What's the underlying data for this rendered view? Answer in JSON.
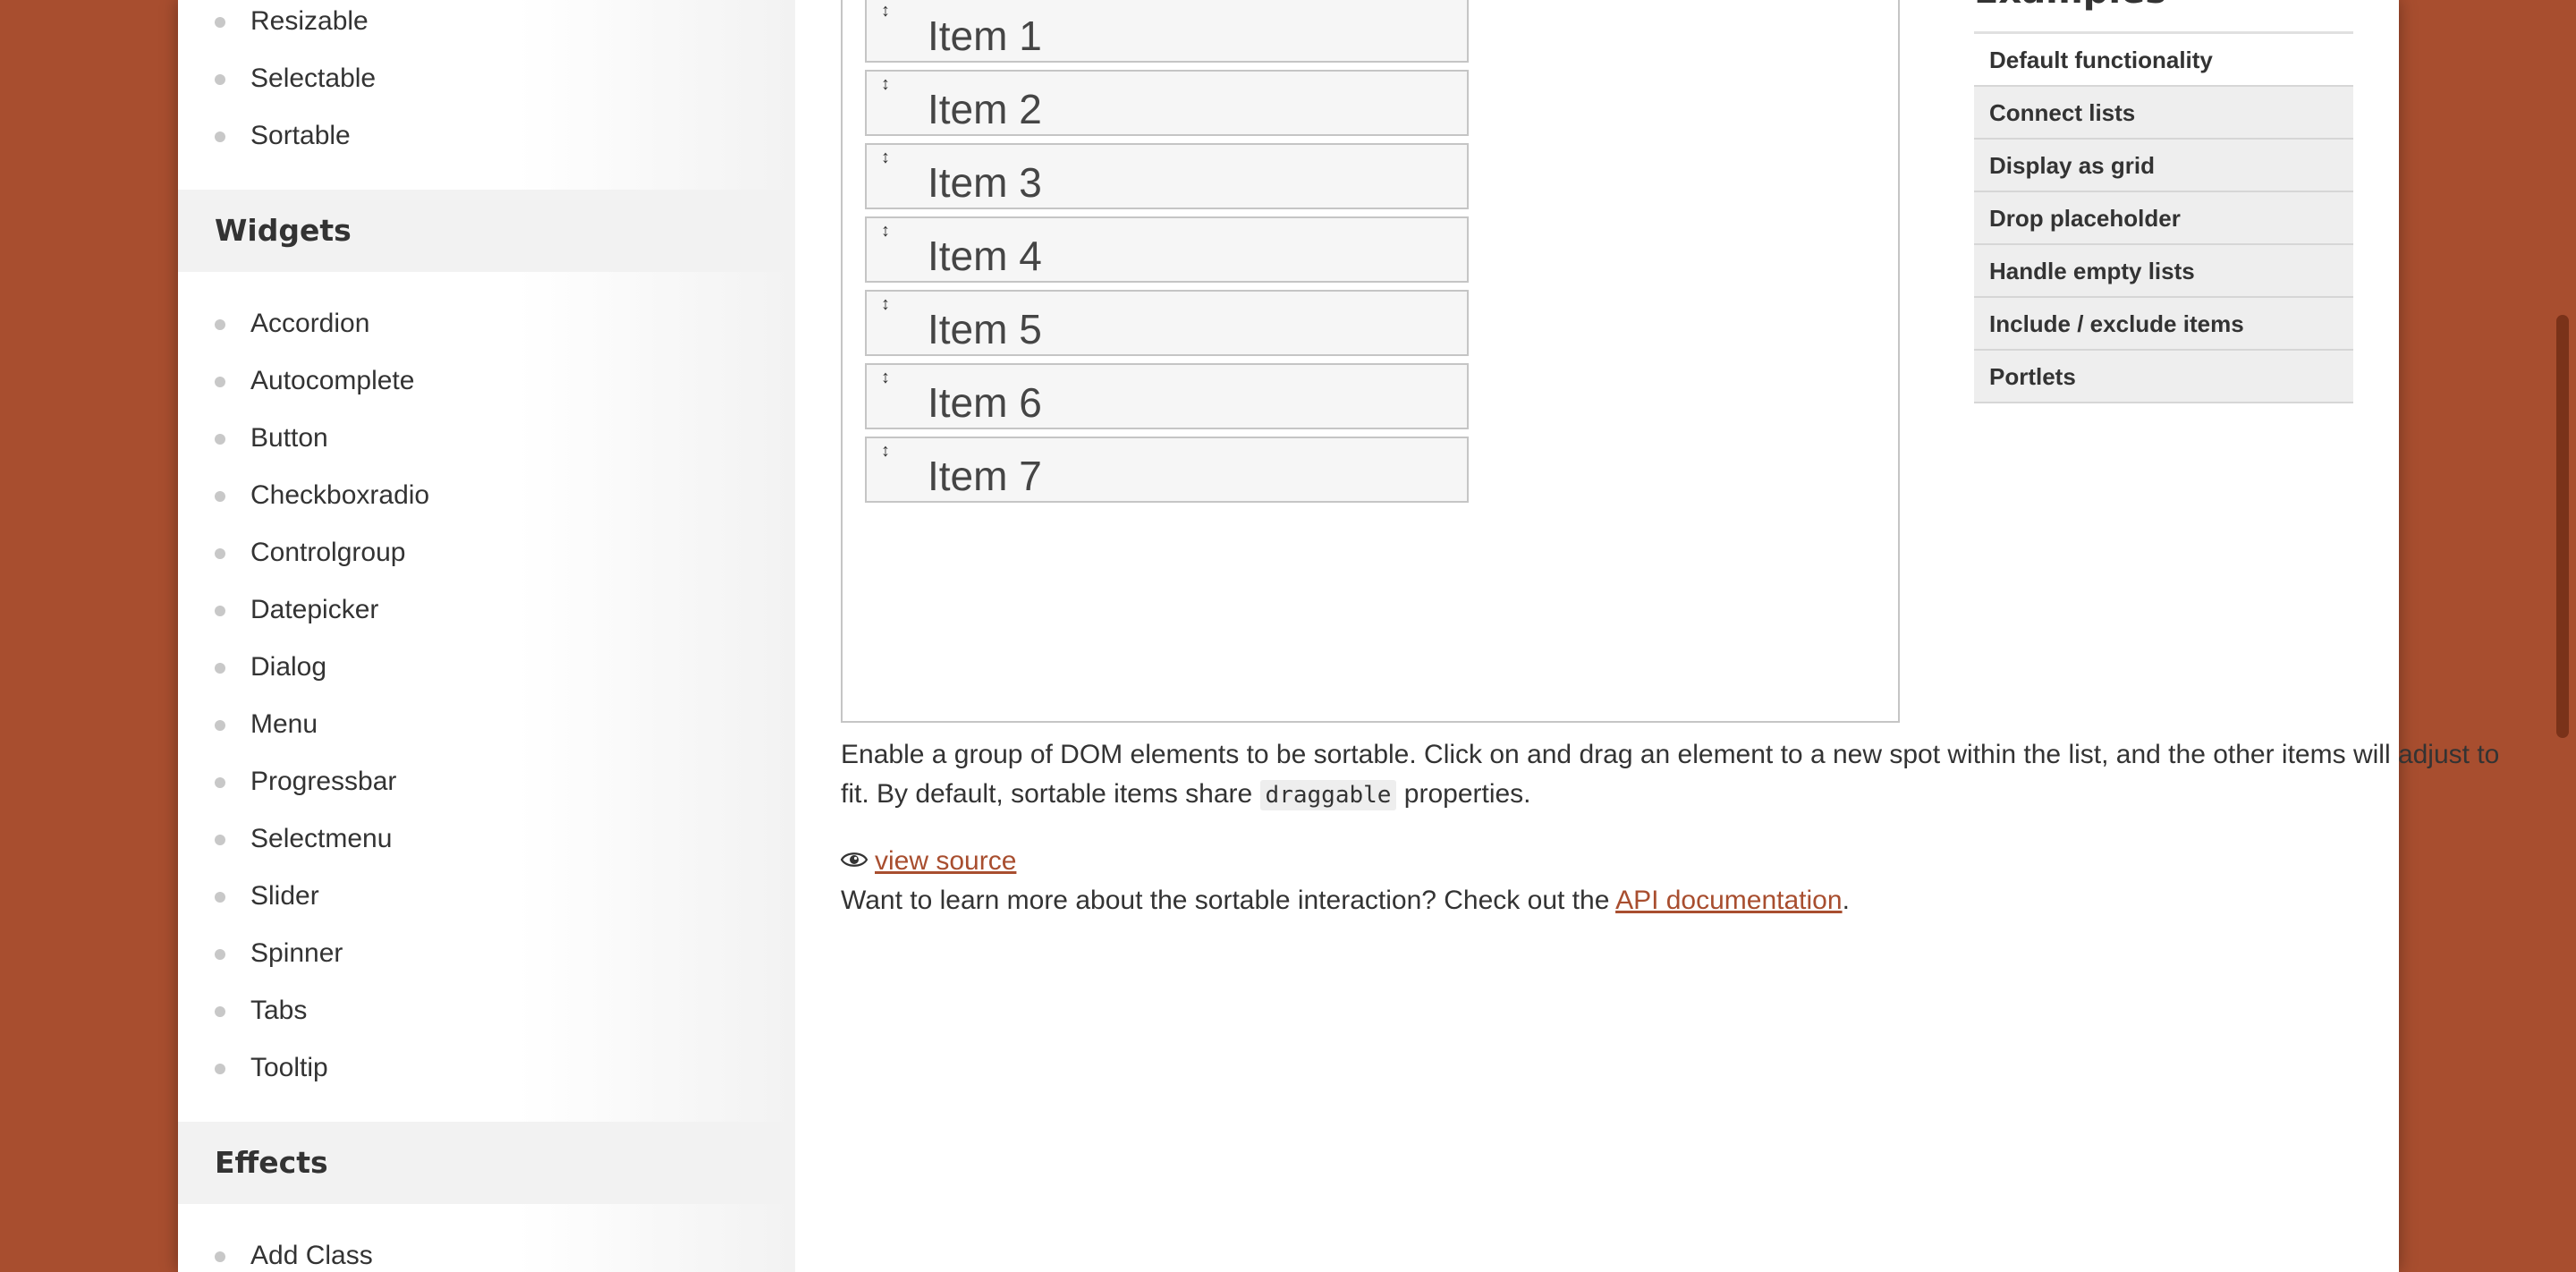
{
  "sidebar": {
    "interactions_items": [
      "Resizable",
      "Selectable",
      "Sortable"
    ],
    "widgets_heading": "Widgets",
    "widgets_items": [
      "Accordion",
      "Autocomplete",
      "Button",
      "Checkboxradio",
      "Controlgroup",
      "Datepicker",
      "Dialog",
      "Menu",
      "Progressbar",
      "Selectmenu",
      "Slider",
      "Spinner",
      "Tabs",
      "Tooltip"
    ],
    "effects_heading": "Effects",
    "effects_items": [
      "Add Class"
    ]
  },
  "demo": {
    "handle_icon": "↕",
    "items": [
      "Item 1",
      "Item 2",
      "Item 3",
      "Item 4",
      "Item 5",
      "Item 6",
      "Item 7"
    ]
  },
  "content": {
    "description_before": "Enable a group of DOM elements to be sortable. Click on and drag an element to a new spot within the list, and the other items will adjust to fit. By default, sortable items share ",
    "description_code": "draggable",
    "description_after": " properties.",
    "view_source_label": "view source",
    "learn_more_before": "Want to learn more about the sortable interaction? Check out the ",
    "learn_more_link": "API documentation",
    "learn_more_after": "."
  },
  "examples": {
    "title": "Examples",
    "items": [
      "Default functionality",
      "Connect lists",
      "Display as grid",
      "Drop placeholder",
      "Handle empty lists",
      "Include / exclude items",
      "Portlets"
    ]
  },
  "colors": {
    "background": "#a84e2f",
    "link": "#a84e2f",
    "scrollbar_thumb": "#7a3219"
  }
}
